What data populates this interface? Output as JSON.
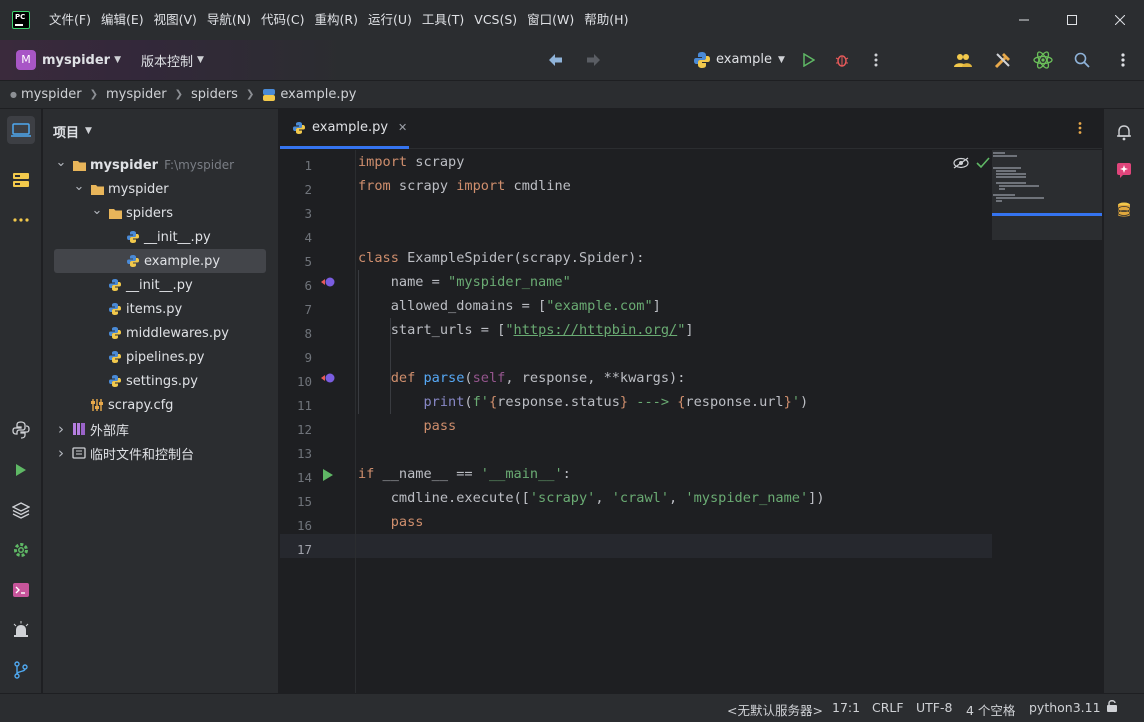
{
  "menu": [
    "文件(F)",
    "编辑(E)",
    "视图(V)",
    "导航(N)",
    "代码(C)",
    "重构(R)",
    "运行(U)",
    "工具(T)",
    "VCS(S)",
    "窗口(W)",
    "帮助(H)"
  ],
  "app_logo_text": "PC",
  "toolbar": {
    "project_badge": "M",
    "project_name": "myspider",
    "vcs_label": "版本控制",
    "run_config": "example"
  },
  "breadcrumb": [
    "myspider",
    "myspider",
    "spiders",
    "example.py"
  ],
  "project_panel": {
    "title": "项目",
    "tree": [
      {
        "label": "myspider",
        "hint": "F:\\myspider",
        "depth": 0,
        "type": "folder",
        "expanded": true,
        "bold": true
      },
      {
        "label": "myspider",
        "depth": 1,
        "type": "folder",
        "expanded": true
      },
      {
        "label": "spiders",
        "depth": 2,
        "type": "folder",
        "expanded": true
      },
      {
        "label": "__init__.py",
        "depth": 3,
        "type": "python"
      },
      {
        "label": "example.py",
        "depth": 3,
        "type": "python",
        "selected": true
      },
      {
        "label": "__init__.py",
        "depth": 2,
        "type": "python"
      },
      {
        "label": "items.py",
        "depth": 2,
        "type": "python"
      },
      {
        "label": "middlewares.py",
        "depth": 2,
        "type": "python"
      },
      {
        "label": "pipelines.py",
        "depth": 2,
        "type": "python"
      },
      {
        "label": "settings.py",
        "depth": 2,
        "type": "python"
      },
      {
        "label": "scrapy.cfg",
        "depth": 1,
        "type": "config"
      },
      {
        "label": "外部库",
        "depth": 0,
        "type": "library",
        "expanded": false
      },
      {
        "label": "临时文件和控制台",
        "depth": 0,
        "type": "scratch",
        "expanded": false
      }
    ]
  },
  "editor": {
    "tab": "example.py",
    "current_line": 17,
    "lines": [
      {
        "n": "1",
        "t": "import scrapy"
      },
      {
        "n": "2",
        "t": "from scrapy import cmdline"
      },
      {
        "n": "3",
        "t": ""
      },
      {
        "n": "4",
        "t": ""
      },
      {
        "n": "5",
        "t": "class ExampleSpider(scrapy.Spider):"
      },
      {
        "n": "6",
        "t": "    name = \"myspider_name\""
      },
      {
        "n": "7",
        "t": "    allowed_domains = [\"example.com\"]"
      },
      {
        "n": "8",
        "t": "    start_urls = [\"https://httpbin.org/\"]"
      },
      {
        "n": "9",
        "t": ""
      },
      {
        "n": "10",
        "t": "    def parse(self, response, **kwargs):"
      },
      {
        "n": "11",
        "t": "        print(f'{response.status} ---> {response.url}')"
      },
      {
        "n": "12",
        "t": "        pass"
      },
      {
        "n": "13",
        "t": ""
      },
      {
        "n": "14",
        "t": "if __name__ == '__main__':"
      },
      {
        "n": "15",
        "t": "    cmdline.execute(['scrapy', 'crawl', 'myspider_name'])"
      },
      {
        "n": "16",
        "t": "    pass"
      },
      {
        "n": "17",
        "t": ""
      }
    ]
  },
  "status_bar": {
    "interpreter_server": "<无默认服务器>",
    "position": "17:1",
    "line_sep": "CRLF",
    "encoding": "UTF-8",
    "indent": "4 个空格",
    "python": "python3.11"
  },
  "colors": {
    "accent": "#3574f0",
    "keyword": "#cf8e6d",
    "string": "#6aab73",
    "function": "#56a8f5"
  }
}
